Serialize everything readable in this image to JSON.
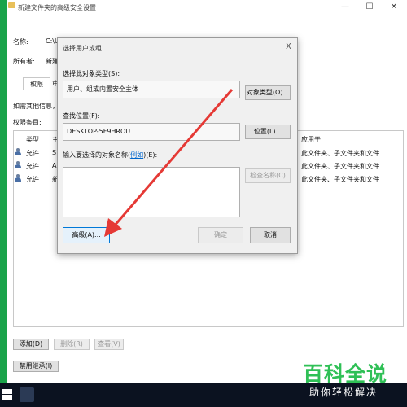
{
  "bg_window": {
    "title": "新建文件夹的高级安全设置",
    "name_label": "名称:",
    "name_value": "C:\\U",
    "owner_label": "所有者:",
    "owner_value": "新建",
    "tabs": [
      "权限",
      "审"
    ],
    "info_text": "如需其他信息，请",
    "perm_entries_label": "权限条目:",
    "col_type": "类型",
    "col_principal": "主",
    "col_applies": "应用于",
    "rows": [
      {
        "type": "允许",
        "principal": "S",
        "applies": "此文件夹、子文件夹和文件"
      },
      {
        "type": "允许",
        "principal": "A",
        "applies": "此文件夹、子文件夹和文件"
      },
      {
        "type": "允许",
        "principal": "新",
        "applies": "此文件夹、子文件夹和文件"
      }
    ],
    "add_button": "添加(D)",
    "remove_button": "删除(R)",
    "view_button": "查看(V)",
    "disable_inherit_button": "禁用继承(I)",
    "win_min": "—",
    "win_max": "☐",
    "win_close": "✕"
  },
  "dialog": {
    "title": "选择用户或组",
    "close": "X",
    "object_type_label": "选择此对象类型(S):",
    "object_type_value": "用户、组或内置安全主体",
    "object_type_button": "对象类型(O)...",
    "location_label": "查找位置(F):",
    "location_value": "DESKTOP-5F9HROU",
    "location_button": "位置(L)...",
    "names_label_prefix": "输入要选择的对象名称(",
    "names_label_link": "例如",
    "names_label_suffix": ")(E):",
    "check_names_button": "检查名称(C)",
    "advanced_button": "高级(A)...",
    "ok_button": "确定",
    "cancel_button": "取消"
  },
  "watermark": {
    "title": "百科全说",
    "subtitle": "助你轻松解决"
  },
  "colors": {
    "accent_green": "#1aa34a",
    "arrow_red": "#e53935",
    "link_blue": "#0066cc",
    "brand_green": "#2fc056"
  }
}
